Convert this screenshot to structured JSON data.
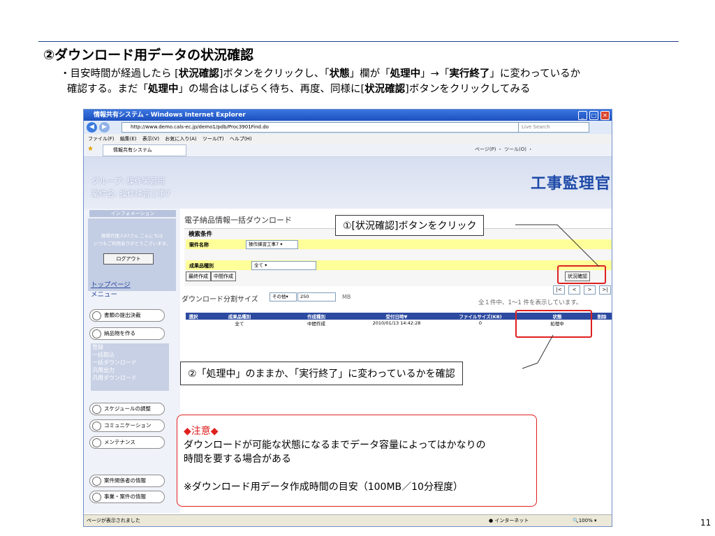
{
  "slide": {
    "title": "②ダウンロード用データの状況確認",
    "bullet_line1_a": "・目安時間が経過したら [",
    "bullet_line1_b": "状況確認",
    "bullet_line1_c": "]ボタンをクリックし、「",
    "bullet_line1_d": "状態",
    "bullet_line1_e": "」欄が「",
    "bullet_line1_f": "処理中",
    "bullet_line1_g": "」→「",
    "bullet_line1_h": "実行終了",
    "bullet_line1_i": "」に変わっているか",
    "bullet_line2_a": "確認する。まだ「",
    "bullet_line2_b": "処理中",
    "bullet_line2_c": "」の場合はしばらく待ち、再度、同様に[",
    "bullet_line2_d": "状況確認",
    "bullet_line2_e": "]ボタンをクリックしてみる",
    "page_number": "11"
  },
  "browser": {
    "window_title": "情報共有システム - Windows Internet Explorer",
    "url": "http://www.demo.cals-ec.jp/demo1/pdb/Proc3901Find.do",
    "live_search": "Live Search",
    "menu": [
      "ファイル(F)",
      "編集(E)",
      "表示(V)",
      "お気に入り(A)",
      "ツール(T)",
      "ヘルプ(H)"
    ],
    "tab_label": "情報共有システム",
    "tools_right": "ページ(P) ・ ツール(O) ・",
    "status_left": "ページが表示されました",
    "status_zone": "インターネット",
    "zoom": "100%"
  },
  "app": {
    "group": "グループ: 操作実習用",
    "project": "案件名: 操作練習工事7",
    "logo": "工事監理官",
    "info_header": "インフォメーション",
    "greeting_line1": "現場代理人07さん こんにちは",
    "greeting_line2": "いつもご利用ありがとうございます。",
    "logout": "ログアウト",
    "top_page": "トップページ",
    "menu_label": "メニュー",
    "nav": {
      "submission": "書類の提出決裁",
      "deliverables": "納品物を作る",
      "sub_items": [
        "登録",
        "一括取込",
        "一括ダウンロード",
        "汎用出力",
        "汎用ダウンロード"
      ],
      "schedule": "スケジュールの調整",
      "communication": "コミュニケーション",
      "maintenance": "メンテナンス",
      "stakeholders": "案件関係者の情報",
      "business": "事業・案件の情報"
    },
    "page_title": "電子納品情報一括ダウンロード",
    "search_label": "検索条件",
    "project_field_label": "案件名称",
    "project_field_value": "操作練習工事7",
    "type_field_label": "成果品種別",
    "type_field_value": "全て",
    "btn_final": "最終作成",
    "btn_mid": "中間作成",
    "btn_status": "状況確認",
    "split_label": "ダウンロード分割サイズ",
    "split_select": "その他",
    "split_value": "250",
    "split_unit": "MB",
    "pager": [
      "|<",
      "<",
      ">",
      ">|"
    ],
    "count_text": "全１件中、1～1 件を表示しています。",
    "table": {
      "headers": [
        "選択",
        "成果品種別",
        "作成種別",
        "受付日時▼",
        "ファイルサイズ(KB)",
        "状態",
        "削除"
      ],
      "rows": [
        [
          "",
          "全て",
          "中間作成",
          "2010/01/13 14:42:28",
          "0",
          "処理中",
          ""
        ]
      ]
    }
  },
  "callouts": {
    "c1": "①[状況確認]ボタンをクリック",
    "c2": "②「処理中」のままか、「実行終了」に変わっているかを確認",
    "note_title": "◆注意◆",
    "note_line1": "ダウンロードが可能な状態になるまでデータ容量によってはかなりの",
    "note_line2": "時間を要する場合がある",
    "note_line3": "※ダウンロード用データ作成時間の目安（100MB／10分程度）"
  },
  "colors": {
    "accent_red": "#e02020",
    "table_header": "#2c4aa0",
    "highlight_yellow": "#ffff99"
  }
}
